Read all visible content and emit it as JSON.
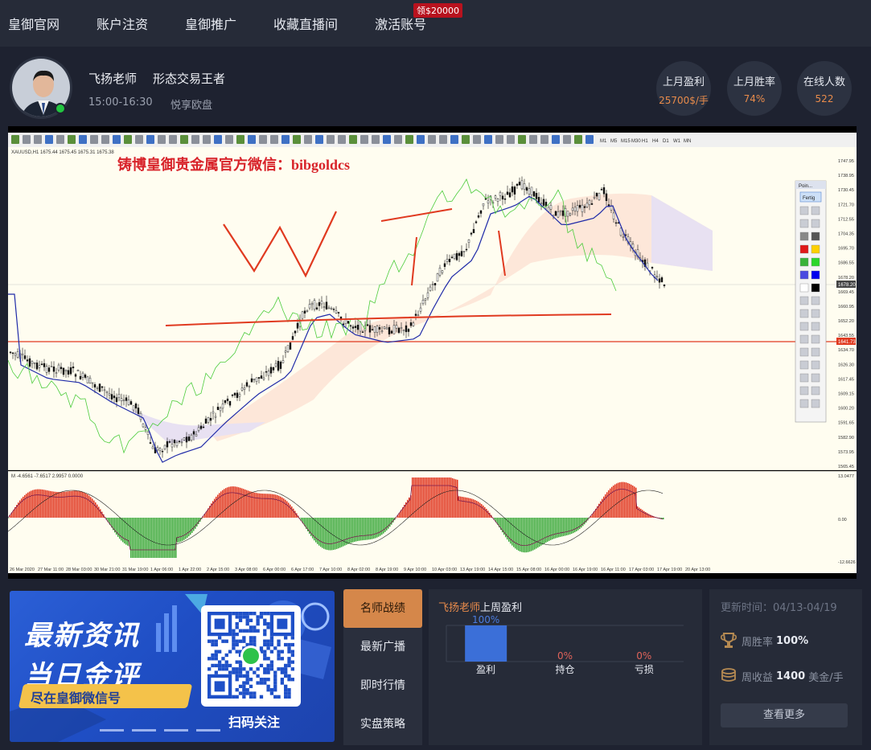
{
  "nav": {
    "items": [
      "皇御官网",
      "账户注资",
      "皇御推广",
      "收藏直播间",
      "激活账号"
    ],
    "badge": "领$20000"
  },
  "profile": {
    "name": "飞扬老师",
    "title": "形态交易王者",
    "time": "15:00-16:30",
    "room": "悦享欧盘"
  },
  "stats": [
    {
      "label": "上月盈利",
      "value": "25700$/手"
    },
    {
      "label": "上月胜率",
      "value": "74%"
    },
    {
      "label": "在线人数",
      "value": "522"
    }
  ],
  "chart_screen": {
    "symbol_bar": "XAUUSD,H1  1675.44 1675.45 1675.31 1675.38",
    "watermark": "铸博皇御贵金属官方微信：bibgoldcs",
    "indicator_label": "M  -4.6561 -7.6517 2.9957 0.0000",
    "price_ticks": [
      "1747.95",
      "1738.95",
      "1730.45",
      "1721.70",
      "1712.55",
      "1704.35",
      "1695.70",
      "1686.55",
      "1678.20",
      "1669.45",
      "1660.95",
      "1652.20",
      "1643.55",
      "1634.70",
      "1626.30",
      "1617.45",
      "1609.15",
      "1600.20",
      "1591.65",
      "1582.90",
      "1573.95",
      "1565.45"
    ],
    "current_price": "1678.20",
    "red_line_price": "1641.73",
    "osc_ticks": [
      "13.0477",
      "0.00",
      "-12.6626"
    ],
    "date_ticks": [
      "26 Mar 2020",
      "27 Mar 11:00",
      "28 Mar 03:00",
      "30 Mar 21:00",
      "31 Mar 19:00",
      "1 Apr 06:00",
      "1 Apr 22:00",
      "2 Apr 15:00",
      "3 Apr 08:00",
      "6 Apr 00:00",
      "6 Apr 17:00",
      "7 Apr 10:00",
      "8 Apr 02:00",
      "8 Apr 19:00",
      "9 Apr 10:00",
      "10 Apr 03:00",
      "13 Apr 19:00",
      "14 Apr 15:00",
      "15 Apr 08:00",
      "16 Apr 00:00",
      "16 Apr 19:00",
      "16 Apr 11:00",
      "17 Apr 03:00",
      "17 Apr 19:00",
      "20 Apr 13:00"
    ],
    "toolbox_title": "Poin...",
    "toolbox_tab": "Fertig",
    "timeframes": [
      "M1",
      "M5",
      "M15",
      "M30",
      "H1",
      "H4",
      "D1",
      "W1",
      "MN"
    ]
  },
  "promo": {
    "line1": "最新资讯",
    "line2": "当日金评",
    "sub": "尽在皇御微信号",
    "scan": "扫码关注"
  },
  "tabs": [
    "名师战绩",
    "最新广播",
    "即时行情",
    "实盘策略"
  ],
  "performance": {
    "teacher": "飞扬老师",
    "period": "上周盈利",
    "chart_data": {
      "type": "bar",
      "categories": [
        "盈利",
        "持仓",
        "亏损"
      ],
      "values": [
        100,
        0,
        0
      ],
      "labels": [
        "100%",
        "0%",
        "0%"
      ],
      "ylim": [
        0,
        100
      ],
      "color": "#3b6fd8"
    }
  },
  "side": {
    "update": "更新时间：04/13-04/19",
    "winrate_label": "周胜率",
    "winrate_value": "100%",
    "income_label": "周收益",
    "income_value": "1400",
    "income_unit": "美金/手",
    "more": "查看更多"
  }
}
